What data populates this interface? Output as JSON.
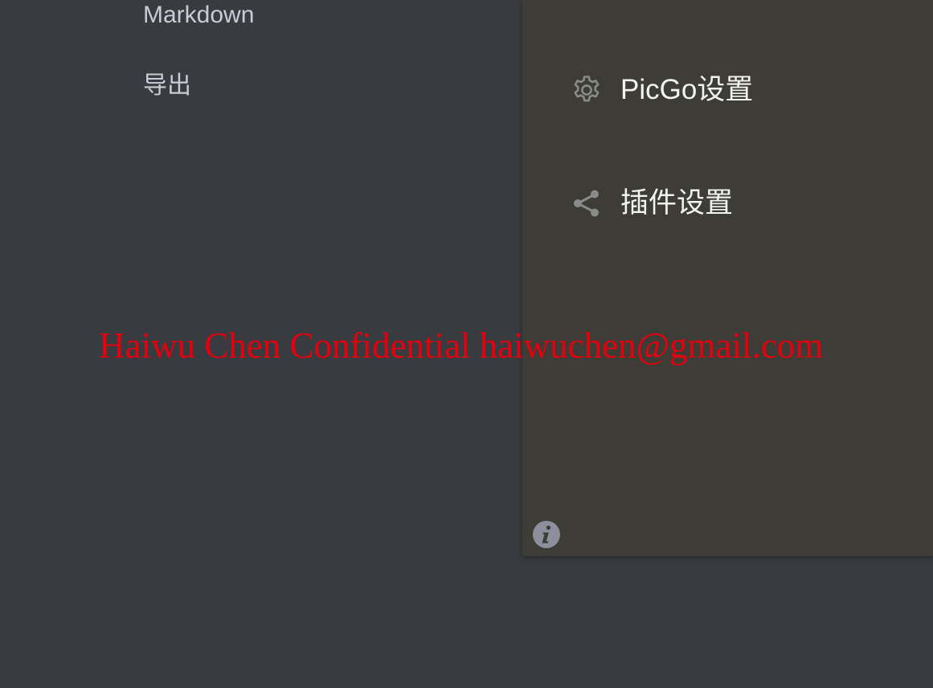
{
  "left_menu": {
    "items": [
      {
        "label": "Markdown"
      },
      {
        "label": "导出"
      }
    ]
  },
  "panel": {
    "items": [
      {
        "label": "PicGo设置",
        "icon": "gear-icon"
      },
      {
        "label": "插件设置",
        "icon": "share-icon"
      }
    ],
    "info_icon": "info-icon"
  },
  "watermark": {
    "text": "Haiwu Chen Confidential haiwuchen@gmail.com",
    "color": "#e5000d"
  },
  "colors": {
    "background": "#383b40",
    "panel_background": "#3d3c37",
    "left_menu_text": "#c9ccd6",
    "panel_text": "#f2f2f2",
    "icon_gray": "#8a8a8a"
  }
}
